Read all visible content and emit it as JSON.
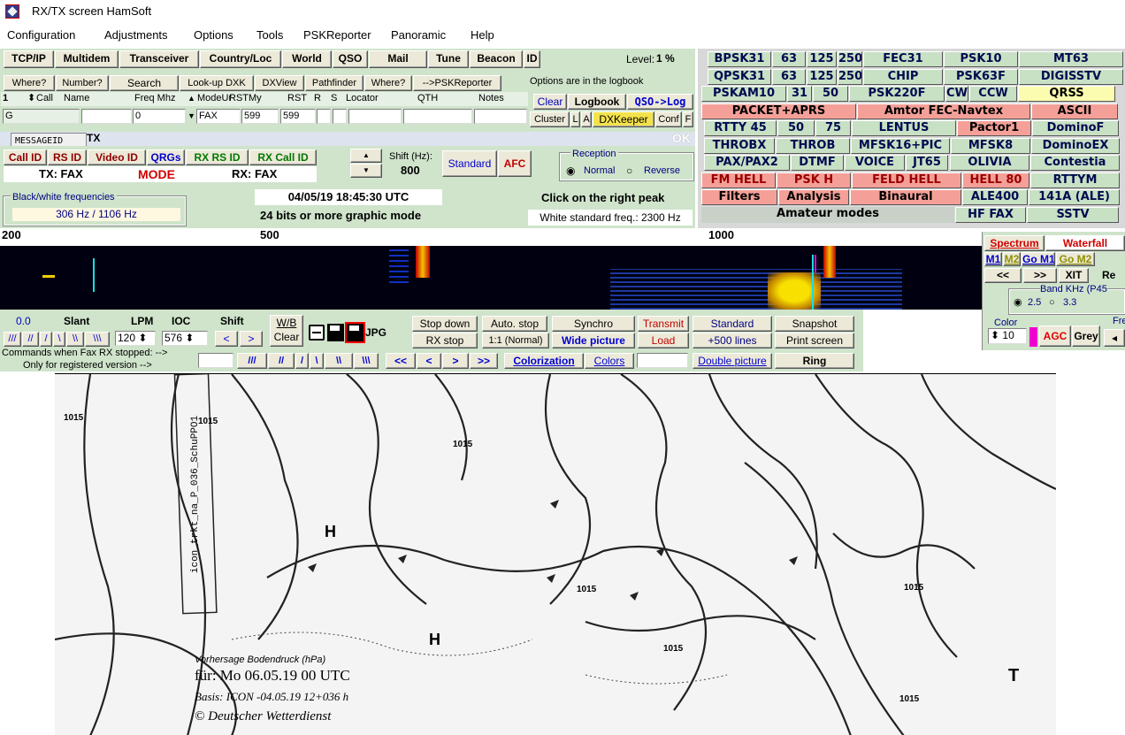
{
  "window": {
    "title": "RX/TX screen  HamSoft"
  },
  "menu": [
    "Configuration",
    "Adjustments",
    "Options",
    "Tools",
    "PSKReporter",
    "Panoramic",
    "Help"
  ],
  "toolbar": [
    "TCP/IP",
    "Multidem",
    "Transceiver",
    "Country/Loc",
    "World",
    "QSO",
    "Mail",
    "Tune",
    "Beacon",
    "ID"
  ],
  "level": {
    "label": "Level:",
    "value": "1 %"
  },
  "row2": {
    "where": "Where?",
    "number": "Number?",
    "search": "Search",
    "lookup": "Look-up DXK",
    "dxview": "DXView",
    "pathfinder": "Pathfinder",
    "where2": "Where?",
    "pskr": "-->PSKReporter",
    "options_note": "Options are in the logbook"
  },
  "qso_headers": {
    "num": "1",
    "call": "Call",
    "name": "Name",
    "freq": "Freq Mhz",
    "modeur": "ModeUr",
    "rstmy": "RSTMy",
    "rst": "RST",
    "r": "R",
    "s": "S",
    "locator": "Locator",
    "qth": "QTH",
    "notes": "Notes"
  },
  "qso_values": {
    "g": "G",
    "freq": "0",
    "mode": "FAX",
    "rst1": "599",
    "rst2": "599"
  },
  "logbtns": {
    "clear": "Clear",
    "logbook": "Logbook",
    "qsolog": "QSO->Log",
    "cluster": "Cluster",
    "l": "L",
    "a": "A",
    "dxkeeper": "DXKeeper",
    "conf": "Conf",
    "f": "F"
  },
  "message": {
    "label": "MESSAGEID",
    "tx": "TX",
    "ok": "OK"
  },
  "idbtns": {
    "callid": "Call ID",
    "rsid": "RS ID",
    "videoid": "Video ID",
    "qrgs": "QRGs",
    "rxrsid": "RX RS ID",
    "rxcallid": "RX Call ID",
    "txfax": "TX: FAX",
    "mode": "MODE",
    "rxfax": "RX: FAX"
  },
  "shift": {
    "label": "Shift (Hz):",
    "value": "800",
    "standard": "Standard",
    "afc": "AFC"
  },
  "reception": {
    "title": "Reception",
    "normal": "Normal",
    "reverse": "Reverse"
  },
  "bw": {
    "title": "Black/white frequencies",
    "value": "306 Hz / 1106 Hz"
  },
  "datetime": "04/05/19 18:45:30 UTC",
  "graphic_mode": "24 bits or more graphic mode",
  "click_peak": "Click on the right peak",
  "white_std": "White standard freq.: 2300 Hz",
  "modes": [
    [
      {
        "t": "BPSK31",
        "c": "mgreen"
      },
      {
        "t": "63",
        "c": "mgreen"
      },
      {
        "t": "125",
        "c": "mgreen"
      },
      {
        "t": "250",
        "c": "mgreen"
      },
      {
        "t": "FEC31",
        "c": "mgreen"
      },
      {
        "t": "PSK10",
        "c": "mgreen"
      },
      {
        "t": "MT63",
        "c": "mgreen"
      }
    ],
    [
      {
        "t": "QPSK31",
        "c": "mgreen"
      },
      {
        "t": "63",
        "c": "mgreen"
      },
      {
        "t": "125",
        "c": "mgreen"
      },
      {
        "t": "250",
        "c": "mgreen"
      },
      {
        "t": "CHIP",
        "c": "mgreen"
      },
      {
        "t": "PSK63F",
        "c": "mgreen"
      },
      {
        "t": "DIGISSTV",
        "c": "mgreen"
      }
    ],
    [
      {
        "t": "PSKAM10",
        "c": "mgreen"
      },
      {
        "t": "31",
        "c": "mgreen"
      },
      {
        "t": "50",
        "c": "mgreen"
      },
      {
        "t": "PSK220F",
        "c": "mgreen"
      },
      {
        "t": "CW",
        "c": "mgreen"
      },
      {
        "t": "CCW",
        "c": "mgreen"
      },
      {
        "t": "QRSS",
        "c": "myel"
      }
    ],
    [
      {
        "t": "PACKET+APRS",
        "c": "mpink"
      },
      {
        "t": "Amtor FEC-Navtex",
        "c": "mpink"
      },
      {
        "t": "ASCII",
        "c": "mpink"
      }
    ],
    [
      {
        "t": "RTTY 45",
        "c": "mgreen"
      },
      {
        "t": "50",
        "c": "mgreen"
      },
      {
        "t": "75",
        "c": "mgreen"
      },
      {
        "t": "LENTUS",
        "c": "mgreen"
      },
      {
        "t": "Pactor1",
        "c": "mpink"
      },
      {
        "t": "DominoF",
        "c": "mgreen"
      }
    ],
    [
      {
        "t": "THROBX",
        "c": "mgreen"
      },
      {
        "t": "THROB",
        "c": "mgreen"
      },
      {
        "t": "MFSK16+PIC",
        "c": "mgreen"
      },
      {
        "t": "MFSK8",
        "c": "mgreen"
      },
      {
        "t": "DominoEX",
        "c": "mgreen"
      }
    ],
    [
      {
        "t": "PAX/PAX2",
        "c": "mgreen"
      },
      {
        "t": "DTMF",
        "c": "mgreen"
      },
      {
        "t": "VOICE",
        "c": "mgreen"
      },
      {
        "t": "JT65",
        "c": "mgreen"
      },
      {
        "t": "OLIVIA",
        "c": "mgreen"
      },
      {
        "t": "Contestia",
        "c": "mgreen"
      }
    ],
    [
      {
        "t": "FM HELL",
        "c": "mred"
      },
      {
        "t": "PSK H",
        "c": "mred"
      },
      {
        "t": "FELD HELL",
        "c": "mred"
      },
      {
        "t": "HELL 80",
        "c": "mred"
      },
      {
        "t": "RTTYM",
        "c": "mgreen"
      }
    ],
    [
      {
        "t": "Filters",
        "c": "mpink"
      },
      {
        "t": "Analysis",
        "c": "mpink"
      },
      {
        "t": "Binaural",
        "c": "mpink"
      },
      {
        "t": "ALE400",
        "c": "mgreen"
      },
      {
        "t": "141A (ALE)",
        "c": "mgreen"
      }
    ],
    [
      {
        "t": "Amateur modes",
        "c": "mgrey"
      },
      {
        "t": "HF FAX",
        "c": "mgreen"
      },
      {
        "t": "SSTV",
        "c": "mgreen"
      }
    ]
  ],
  "scale": {
    "a": "200",
    "b": "500",
    "c": "1000"
  },
  "spectrum": {
    "spectrum": "Spectrum",
    "waterfall": "Waterfall",
    "m1": "M1",
    "m2": "M2",
    "gom1": "Go M1",
    "gom2": "Go M2",
    "left": "<<",
    "right": ">>",
    "xit": "XIT",
    "re": "Re",
    "bandkhz": "Band KHz (P45",
    "b1": "2.5",
    "b2": "3.3",
    "color": "Color",
    "colorval": "10",
    "agc": "AGC",
    "grey": "Grey",
    "freq": "Freq"
  },
  "fax": {
    "val": "0.0",
    "slant": "Slant",
    "lpm": "LPM",
    "ioc": "IOC",
    "shift": "Shift",
    "wb": "W/B",
    "clear": "Clear",
    "lpmval": "120",
    "iocval": "576",
    "jpg": "JPG",
    "stopdown": "Stop down",
    "rxstop": "RX stop",
    "autostop": "Auto. stop",
    "normal": "1:1 (Normal)",
    "synchro": "Synchro",
    "wide": "Wide picture",
    "transmit": "Transmit",
    "load": "Load",
    "standard": "Standard",
    "plus500": "+500 lines",
    "snapshot": "Snapshot",
    "printscreen": "Print screen",
    "cmds": "Commands when Fax RX stopped: -->",
    "reg": "Only for registered version -->",
    "colorization": "Colorization",
    "colors": "Colors",
    "double": "Double picture",
    "ring": "Ring",
    "slantbtns": [
      "///",
      "//",
      "/",
      "\\",
      "\\\\",
      "\\\\\\"
    ],
    "nav": [
      "<<",
      "<",
      ">",
      ">>"
    ]
  },
  "map": {
    "l1": "Vorhersage Bodendruck (hPa)",
    "l2": "für:  Mo 06.05.19  00 UTC",
    "l3": "Basis: ICON -04.05.19 12+036 h",
    "l4": "© Deutscher Wetterdienst",
    "vlabel": "icon_trkt_na_P_036_SchuPPO1",
    "H": "H",
    "T": "T",
    "i1": "1015",
    "i2": "1015",
    "i3": "1015",
    "i4": "1015",
    "i5": "1015",
    "i6": "1015",
    "i7": "1015",
    "p1": "1015"
  }
}
